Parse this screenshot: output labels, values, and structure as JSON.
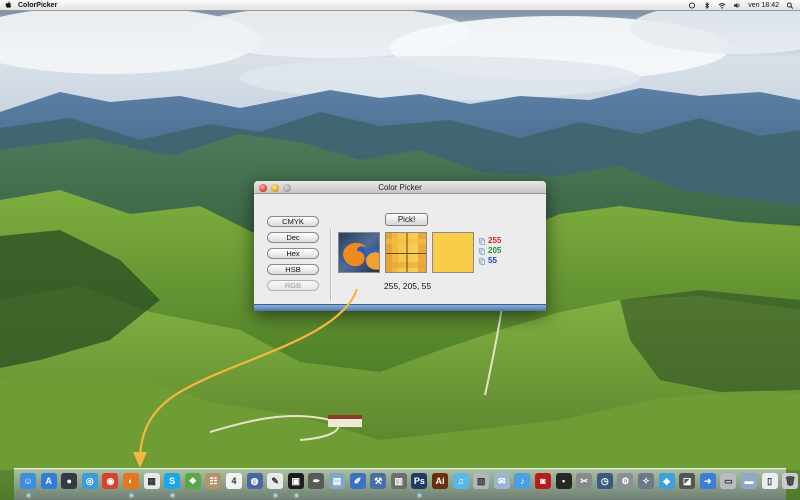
{
  "menubar": {
    "app_name": "ColorPicker",
    "clock": "ven 18:42"
  },
  "window": {
    "title": "Color Picker",
    "format_buttons": [
      "CMYK",
      "Dec",
      "Hex",
      "HSB",
      "RGB"
    ],
    "selected_format": "RGB",
    "pick_label": "Pick!",
    "picked_color": "#f8cd4a",
    "rgb": {
      "r": "255",
      "g": "205",
      "b": "55"
    },
    "rgb_string": "255, 205, 55"
  },
  "colors": {
    "accent_arrow": "#f5b740",
    "red_value": "#e02020",
    "green_value": "#1f9a2c",
    "blue_value": "#2345d4"
  },
  "dock": {
    "items": [
      {
        "name": "finder-icon",
        "glyph": "☺",
        "color": "#3c8fe0",
        "running": true
      },
      {
        "name": "app-store-icon",
        "glyph": "A",
        "color": "#2f7ed8",
        "running": false
      },
      {
        "name": "dashboard-icon",
        "glyph": "●",
        "color": "#333a44",
        "running": false
      },
      {
        "name": "safari-icon",
        "glyph": "◎",
        "color": "#3a9be0",
        "running": false
      },
      {
        "name": "chrome-icon",
        "glyph": "◉",
        "color": "#d8412f",
        "running": false
      },
      {
        "name": "firefox-icon",
        "glyph": "◐",
        "color": "#e3761f",
        "running": true
      },
      {
        "name": "ical-icon",
        "glyph": "▦",
        "color": "#e8e8e8",
        "running": false
      },
      {
        "name": "skype-icon",
        "glyph": "S",
        "color": "#18a7e8",
        "running": true
      },
      {
        "name": "share-icon",
        "glyph": "❖",
        "color": "#5ba84a",
        "running": false
      },
      {
        "name": "contacts-icon",
        "glyph": "☷",
        "color": "#b4926a",
        "running": false
      },
      {
        "name": "calendar-icon",
        "glyph": "4",
        "color": "#f2f2f2",
        "running": false
      },
      {
        "name": "globe-icon",
        "glyph": "◍",
        "color": "#4966a8",
        "running": false
      },
      {
        "name": "textedit-icon",
        "glyph": "✎",
        "color": "#e9e9e9",
        "running": true
      },
      {
        "name": "terminal-icon",
        "glyph": "▣",
        "color": "#1d1d1d",
        "running": true
      },
      {
        "name": "pen-icon",
        "glyph": "✒",
        "color": "#5a5a5a",
        "running": false
      },
      {
        "name": "image-viewer-icon",
        "glyph": "▤",
        "color": "#7fa7c9",
        "running": false
      },
      {
        "name": "notes-icon",
        "glyph": "✐",
        "color": "#3d72c2",
        "running": false
      },
      {
        "name": "xcode-icon",
        "glyph": "⚒",
        "color": "#4a6fa8",
        "running": false
      },
      {
        "name": "gallery-icon",
        "glyph": "▥",
        "color": "#6d6d6d",
        "running": false
      },
      {
        "name": "photoshop-icon",
        "glyph": "Ps",
        "color": "#1e3b64",
        "running": true
      },
      {
        "name": "illustrator-icon",
        "glyph": "Ai",
        "color": "#6b2d0b",
        "running": false
      },
      {
        "name": "itunes-icon",
        "glyph": "♫",
        "color": "#5bb7e8",
        "running": false
      },
      {
        "name": "preview-icon",
        "glyph": "▧",
        "color": "#b0b7bf",
        "running": false
      },
      {
        "name": "mail-icon",
        "glyph": "✉",
        "color": "#9cb6d1",
        "running": false
      },
      {
        "name": "music-icon",
        "glyph": "♪",
        "color": "#4aa0e0",
        "running": false
      },
      {
        "name": "photobooth-icon",
        "glyph": "◙",
        "color": "#b51c1c",
        "running": false
      },
      {
        "name": "dvd-icon",
        "glyph": "▪",
        "color": "#262626",
        "running": false
      },
      {
        "name": "scissors-icon",
        "glyph": "✂",
        "color": "#8a8a8a",
        "running": false
      },
      {
        "name": "time-machine-icon",
        "glyph": "◷",
        "color": "#3b5a82",
        "running": false
      },
      {
        "name": "system-preferences-icon",
        "glyph": "⚙",
        "color": "#8a8f96",
        "running": false
      },
      {
        "name": "compass-icon",
        "glyph": "✧",
        "color": "#6b7a8a",
        "running": false
      },
      {
        "name": "bird-icon",
        "glyph": "◆",
        "color": "#3aa0e0",
        "running": false
      },
      {
        "name": "crop-icon",
        "glyph": "◪",
        "color": "#555555",
        "running": false
      },
      {
        "name": "launcher-icon",
        "glyph": "➜",
        "color": "#3c7bd6",
        "running": false
      },
      {
        "name": "trash-bin-icon",
        "glyph": "▭",
        "color": "#b6bcc2",
        "running": false
      },
      {
        "name": "downloads-folder-icon",
        "glyph": "▬",
        "color": "#8fa8c4",
        "running": false
      },
      {
        "name": "document-icon",
        "glyph": "▯",
        "color": "#e9eef3",
        "running": false
      },
      {
        "name": "trash-icon",
        "glyph": "🗑",
        "color": "#c9cdd1",
        "running": false
      }
    ]
  }
}
